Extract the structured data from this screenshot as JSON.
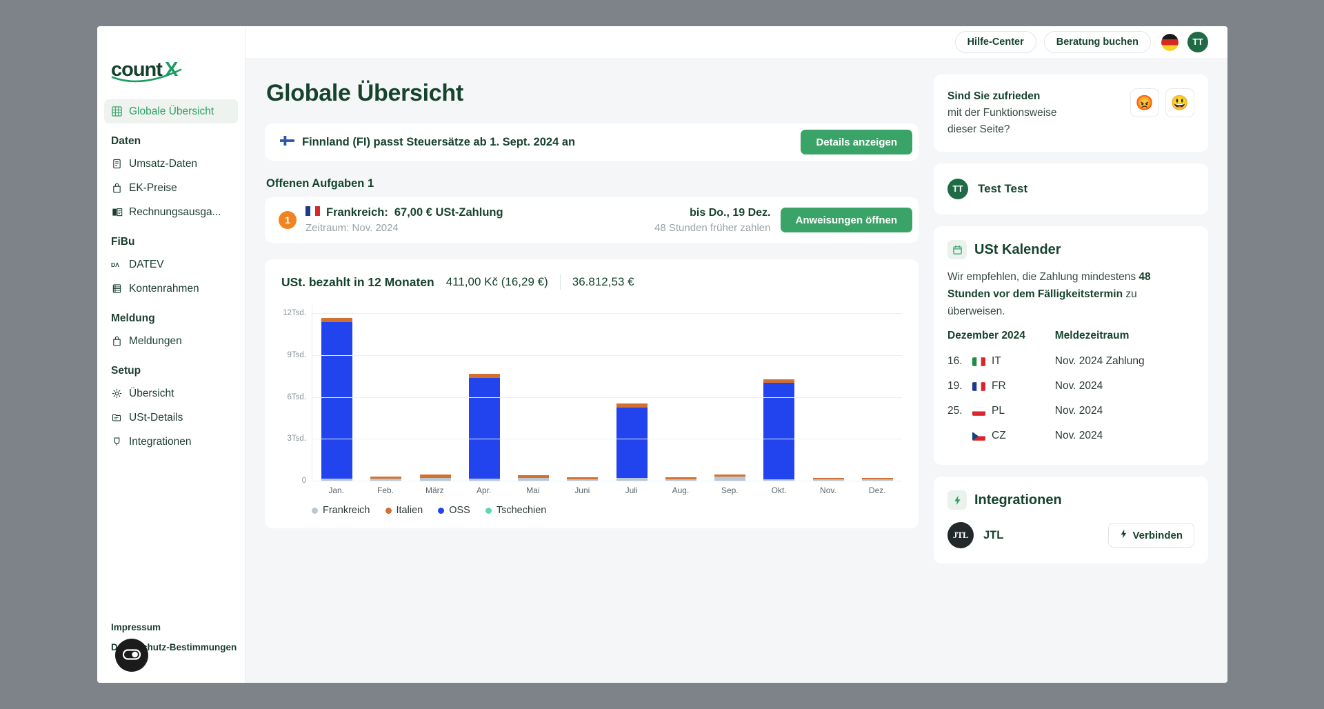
{
  "brand": {
    "name": "countX",
    "accent": "#1f6b46",
    "accent_light": "#2e9e63"
  },
  "topbar": {
    "help_center": "Hilfe-Center",
    "book_consult": "Beratung buchen",
    "language_flag": "de-flag-icon",
    "avatar_initials": "TT"
  },
  "sidebar": {
    "active_item": "Globale Übersicht",
    "items": [
      {
        "label": "Globale Übersicht",
        "icon": "grid-icon",
        "type": "item",
        "active": true
      },
      {
        "label": "Daten",
        "type": "group"
      },
      {
        "label": "Umsatz-Daten",
        "icon": "document-icon",
        "type": "item"
      },
      {
        "label": "EK-Preise",
        "icon": "bag-icon",
        "type": "item"
      },
      {
        "label": "Rechnungsausga...",
        "icon": "book-icon",
        "type": "item"
      },
      {
        "label": "FiBu",
        "type": "group"
      },
      {
        "label": "DATEV",
        "icon": "datev-icon",
        "type": "item"
      },
      {
        "label": "Kontenrahmen",
        "icon": "ledger-icon",
        "type": "item"
      },
      {
        "label": "Meldung",
        "type": "group"
      },
      {
        "label": "Meldungen",
        "icon": "briefcase-icon",
        "type": "item"
      },
      {
        "label": "Setup",
        "type": "group"
      },
      {
        "label": "Übersicht",
        "icon": "gear-icon",
        "type": "item"
      },
      {
        "label": "USt-Details",
        "icon": "folder-icon",
        "type": "item"
      },
      {
        "label": "Integrationen",
        "icon": "plug-icon",
        "type": "item"
      }
    ],
    "footer": {
      "impressum": "Impressum",
      "privacy": "Datenschutz-Bestimmungen",
      "cookie_button": "cookie-consent-icon"
    }
  },
  "main": {
    "page_title": "Globale Übersicht",
    "alert": {
      "flag": "fi-flag-icon",
      "text": "Finnland (FI) passt Steuersätze ab 1. Sept. 2024 an",
      "button": "Details anzeigen"
    },
    "tasks_heading": "Offenen Aufgaben 1",
    "task": {
      "count": "1",
      "flag": "fr-flag-icon",
      "country": "Frankreich:",
      "amount": "67,00 € USt-Zahlung",
      "period": "Zeitraum: Nov. 2024",
      "due": "bis Do., 19 Dez.",
      "due_note": "48 Stunden früher zahlen",
      "button": "Anweisungen öffnen"
    }
  },
  "chart_data": {
    "type": "bar",
    "stacked": true,
    "title": "USt. bezahlt in 12 Monaten",
    "header_values": [
      "411,00 Kč (16,29 €)",
      "36.812,53 €"
    ],
    "categories": [
      "Jan.",
      "Feb.",
      "März",
      "Apr.",
      "Mai",
      "Juni",
      "Juli",
      "Aug.",
      "Sep.",
      "Okt.",
      "Nov.",
      "Dez."
    ],
    "ylim": [
      0,
      12600
    ],
    "yticks": [
      0,
      3000,
      6000,
      9000,
      12000
    ],
    "ytick_labels": [
      "0",
      "3Tsd.",
      "6Tsd.",
      "9Tsd.",
      "12Tsd."
    ],
    "xlabel": "",
    "ylabel": "",
    "grid": true,
    "legend_position": "bottom-left",
    "series": [
      {
        "name": "Frankreich",
        "color": "#b9c8d6",
        "values": [
          150,
          130,
          200,
          160,
          200,
          80,
          190,
          120,
          290,
          40,
          20,
          10
        ]
      },
      {
        "name": "Italien",
        "color": "#d2702f",
        "values": [
          330,
          170,
          250,
          300,
          180,
          140,
          300,
          110,
          160,
          280,
          120,
          110
        ]
      },
      {
        "name": "OSS",
        "color": "#2244ee",
        "values": [
          11200,
          0,
          0,
          7200,
          0,
          0,
          5050,
          0,
          0,
          6900,
          0,
          0
        ]
      },
      {
        "name": "Tschechien",
        "color": "#62d6b4",
        "values": [
          0,
          0,
          0,
          0,
          0,
          0,
          0,
          0,
          0,
          0,
          0,
          0
        ]
      }
    ]
  },
  "right": {
    "feedback": {
      "line1": "Sind Sie zufrieden",
      "line2": "mit der Funktionsweise",
      "line3": "dieser Seite?",
      "negative": "😡",
      "positive": "😃"
    },
    "user": {
      "initials": "TT",
      "name": "Test Test"
    },
    "calendar": {
      "icon": "calendar-icon",
      "title": "USt Kalender",
      "note_1": "Wir empfehlen, die Zahlung mindestens ",
      "note_bold": "48 Stunden vor dem Fälligkeitstermin",
      "note_2": " zu überweisen.",
      "col_month": "Dezember 2024",
      "col_period": "Meldezeitraum",
      "rows": [
        {
          "day": "16.",
          "flag": "it-flag-icon",
          "code": "IT",
          "period": "Nov. 2024 Zahlung"
        },
        {
          "day": "19.",
          "flag": "fr-flag-icon",
          "code": "FR",
          "period": "Nov. 2024"
        },
        {
          "day": "25.",
          "flag": "pl-flag-icon",
          "code": "PL",
          "period": "Nov. 2024"
        },
        {
          "day": "",
          "flag": "cz-flag-icon",
          "code": "CZ",
          "period": "Nov. 2024"
        }
      ]
    },
    "integrations": {
      "icon": "bolt-icon",
      "title": "Integrationen",
      "item_name": "JTL",
      "item_logo": "jtl-logo-icon",
      "connect_button": "Verbinden"
    }
  }
}
